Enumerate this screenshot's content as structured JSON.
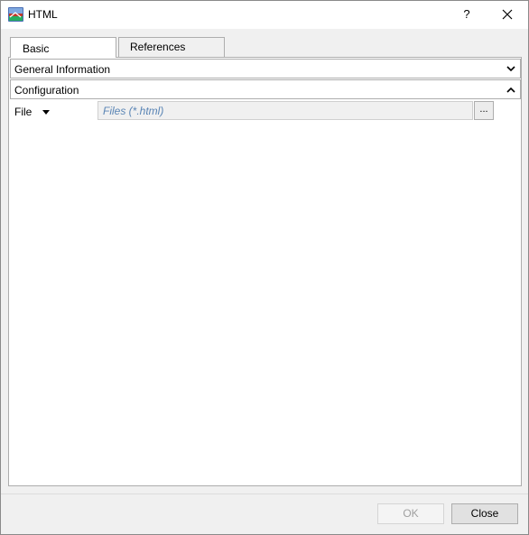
{
  "window": {
    "title": "HTML",
    "help_label": "?"
  },
  "tabs": [
    {
      "label": "Basic",
      "active": true
    },
    {
      "label": "References",
      "active": false
    }
  ],
  "sections": {
    "general": {
      "label": "General Information",
      "expanded": false
    },
    "configuration": {
      "label": "Configuration",
      "expanded": true
    }
  },
  "file_row": {
    "label": "File",
    "placeholder": "Files (*.html)",
    "browse_label": "..."
  },
  "footer": {
    "ok_label": "OK",
    "ok_enabled": false,
    "close_label": "Close"
  },
  "colors": {
    "panel_bg": "#ffffff",
    "dialog_bg": "#f0f0f0",
    "border": "#adadad",
    "placeholder_text": "#5a85b5",
    "disabled_text": "#a0a0a0"
  }
}
